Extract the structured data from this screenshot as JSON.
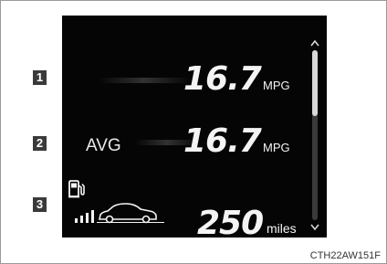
{
  "markers": [
    "1",
    "2",
    "3"
  ],
  "rows": [
    {
      "value": "16.7",
      "unit": "MPG",
      "label": ""
    },
    {
      "value": "16.7",
      "unit": "MPG",
      "label": "AVG"
    },
    {
      "value": "250",
      "unit": "miles",
      "label": ""
    }
  ],
  "icons": {
    "fuel": "fuel-pump-icon",
    "range": "car-range-icon",
    "scroll_up": "chevron-up-icon",
    "scroll_down": "chevron-down-icon"
  },
  "colors": {
    "screen": "#050505",
    "text": "#f4f4f4",
    "marker": "#3a3a3a",
    "scroll_thumb": "#d8d8d8"
  },
  "caption": "CTH22AW151F"
}
